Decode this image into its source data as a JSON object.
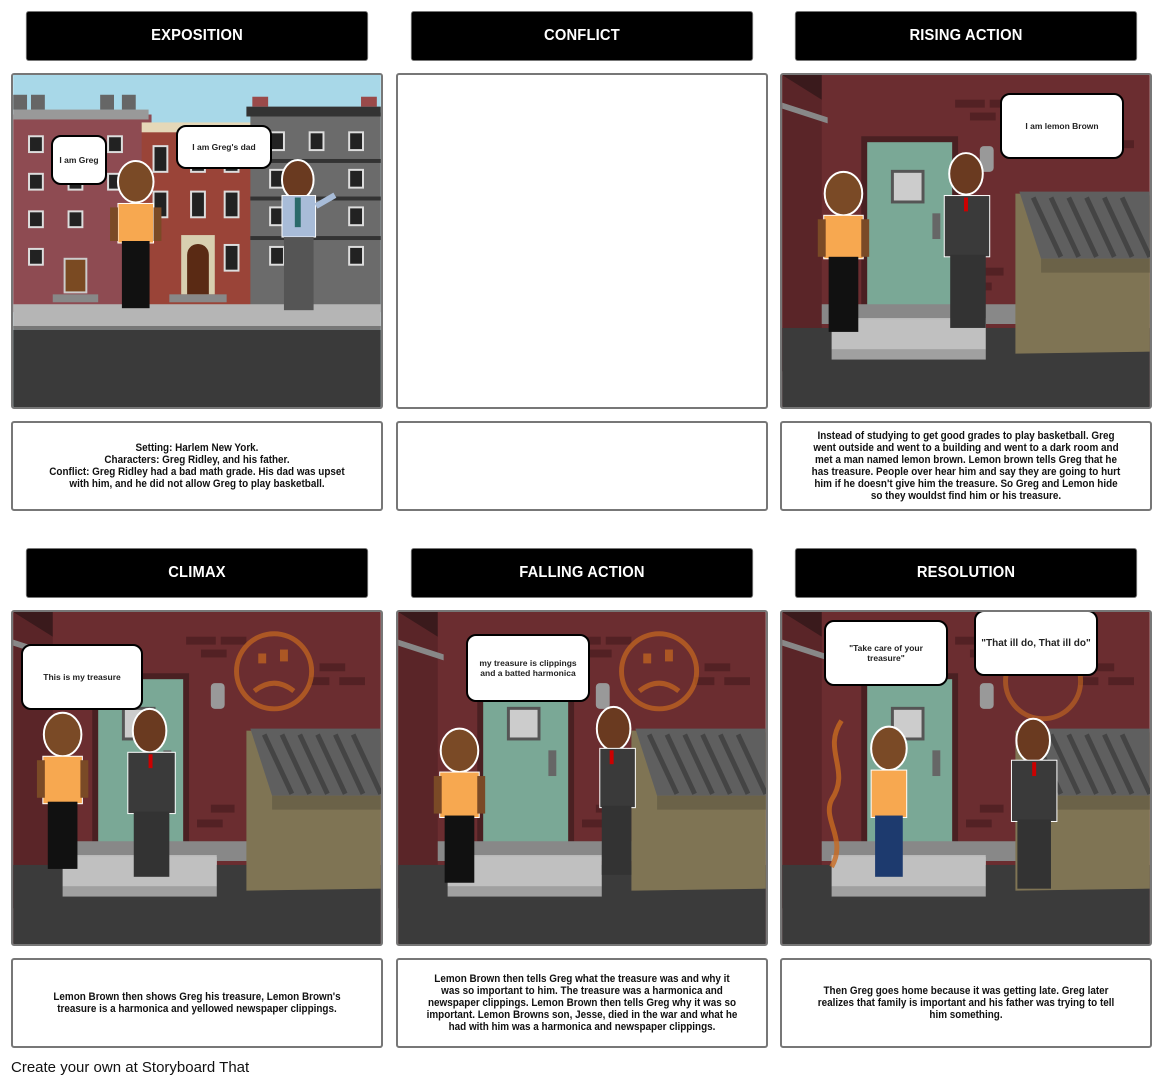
{
  "storyboard": {
    "footer": "Create your own at Storyboard That",
    "cells": [
      {
        "title": "EXPOSITION",
        "scene": "city-street",
        "bubbles": [
          "I am Greg",
          "I am Greg's dad"
        ],
        "caption": "Setting: Harlem New York.\nCharacters: Greg Ridley, and his father.\nConflict: Greg Ridley had a bad math grade. His dad was upset with him, and he did not allow Greg to play basketball."
      },
      {
        "title": "CONFLICT",
        "scene": "empty",
        "bubbles": [],
        "caption": ""
      },
      {
        "title": "RISING ACTION",
        "scene": "alley",
        "bubbles": [
          "I am lemon Brown"
        ],
        "caption": "Instead of studying to get good grades to play basketball. Greg went outside and went to a building and went to a dark room and met a man named lemon brown. Lemon brown tells Greg that he has treasure. People over hear him and say they are going to hurt him if he doesn't give him the treasure. So Greg and Lemon hide so they wouldst find him or his treasure."
      },
      {
        "title": "CLIMAX",
        "scene": "alley",
        "bubbles": [
          "This is my treasure"
        ],
        "caption": "Lemon Brown then shows Greg his treasure, Lemon Brown's treasure is a harmonica and yellowed newspaper clippings."
      },
      {
        "title": "FALLING ACTION",
        "scene": "alley",
        "bubbles": [
          "my treasure is clippings and a batted harmonica"
        ],
        "caption": "Lemon Brown then tells Greg what the treasure was and why it was so important to him. The treasure was a harmonica and newspaper clippings. Lemon Brown then tells Greg why it was so important. Lemon Browns son, Jesse, died in the war and what he had with him was a harmonica and newspaper clippings."
      },
      {
        "title": "RESOLUTION",
        "scene": "alley",
        "bubbles": [
          "\"Take care of your treasure\"",
          "\"That ill do, That ill do\""
        ],
        "caption": "Then Greg goes home because it was getting late. Greg later realizes that family is important and his father was trying to tell him something."
      }
    ]
  },
  "colors": {
    "title_bg": "#000000",
    "frame_border": "#777777",
    "sky": "#a8d8e8",
    "brick_red": "#8a4a4e",
    "alley_wall": "#6b2d30",
    "door_green": "#7aa896",
    "shirt_orange": "#f7a850",
    "suit_gray": "#3a3a3a",
    "ground_dark": "#3b3b3b"
  }
}
